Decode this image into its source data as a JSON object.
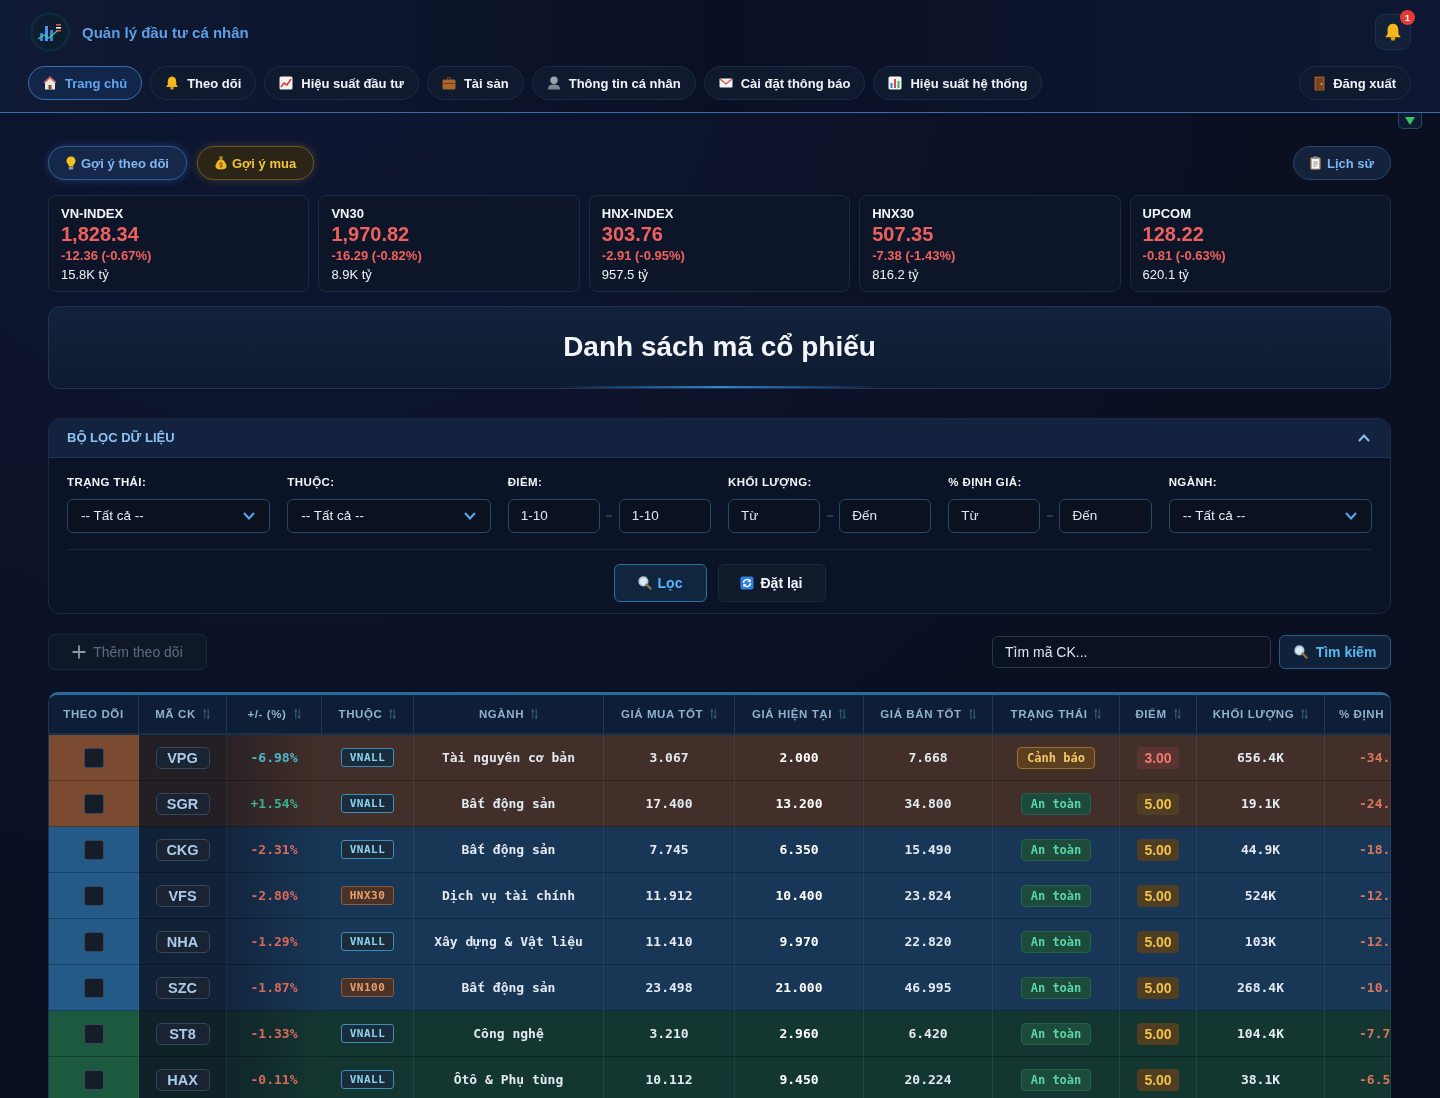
{
  "header": {
    "app_title": "Quản lý đầu tư cá nhân",
    "notification_count": "1",
    "nav": [
      {
        "label": "Trang chủ",
        "selected": true
      },
      {
        "label": "Theo dõi",
        "selected": false
      },
      {
        "label": "Hiệu suất đầu tư",
        "selected": false
      },
      {
        "label": "Tài sản",
        "selected": false
      },
      {
        "label": "Thông tin cá nhân",
        "selected": false
      },
      {
        "label": "Cài đặt thông báo",
        "selected": false
      },
      {
        "label": "Hiệu suất hệ thống",
        "selected": false
      }
    ],
    "logout": "Đăng xuất",
    "panel_toggle": {
      "expanded": false
    }
  },
  "suggestions": [
    {
      "label": "Gợi ý theo dõi",
      "kind": "watch"
    },
    {
      "label": "Gợi ý mua",
      "kind": "buy"
    }
  ],
  "history_button": "Lịch sử",
  "indices": [
    {
      "name": "VN-INDEX",
      "value": "1,828.34",
      "change": "-12.36 (-0.67%)",
      "volume": "15.8K tỷ",
      "falling": true
    },
    {
      "name": "VN30",
      "value": "1,970.82",
      "change": "-16.29 (-0.82%)",
      "volume": "8.9K tỷ",
      "falling": true
    },
    {
      "name": "HNX-INDEX",
      "value": "303.76",
      "change": "-2.91 (-0.95%)",
      "volume": "957.5 tỷ",
      "falling": true
    },
    {
      "name": "HNX30",
      "value": "507.35",
      "change": "-7.38 (-1.43%)",
      "volume": "816.2 tỷ",
      "falling": true
    },
    {
      "name": "UPCOM",
      "value": "128.22",
      "change": "-0.81 (-0.63%)",
      "volume": "620.1 tỷ",
      "falling": true
    }
  ],
  "page_title": "Danh sách mã cổ phiếu",
  "filter": {
    "title": "BỘ LỌC DỮ LIỆU",
    "expanded": true,
    "fields": [
      {
        "kind": "select",
        "label": "TRẠNG THÁI:",
        "value": "-- Tất cả --"
      },
      {
        "kind": "select",
        "label": "THUỘC:",
        "value": "-- Tất cả --"
      },
      {
        "kind": "range",
        "label": "ĐIỂM:",
        "from": {
          "placeholder": "1-10"
        },
        "to": {
          "placeholder": "1-10"
        }
      },
      {
        "kind": "range",
        "label": "KHỐI LƯỢNG:",
        "from": {
          "placeholder": "Từ"
        },
        "to": {
          "placeholder": "Đến"
        }
      },
      {
        "kind": "range",
        "label": "% ĐỊNH GIÁ:",
        "from": {
          "placeholder": "Từ"
        },
        "to": {
          "placeholder": "Đến"
        }
      },
      {
        "kind": "select",
        "label": "NGÀNH:",
        "value": "-- Tất cả --"
      }
    ],
    "buttons": [
      {
        "label": "Lọc",
        "kind": "apply"
      },
      {
        "label": "Đặt lại",
        "kind": "reset"
      }
    ]
  },
  "toolbar": {
    "add_watch": {
      "label": "Thêm theo dõi",
      "disabled": true
    },
    "search": {
      "placeholder": "Tìm mã CK..."
    },
    "search_button": "Tìm kiếm"
  },
  "table": {
    "columns": [
      {
        "label": "THEO DÕI",
        "sortable": false
      },
      {
        "label": "MÃ CK",
        "sortable": true
      },
      {
        "label": "+/- (%)",
        "sortable": true
      },
      {
        "label": "THUỘC",
        "sortable": true
      },
      {
        "label": "NGÀNH",
        "sortable": true
      },
      {
        "label": "GIÁ MUA TỐT",
        "sortable": true
      },
      {
        "label": "GIÁ HIỆN TẠI",
        "sortable": true
      },
      {
        "label": "GIÁ BÁN TỐT",
        "sortable": true
      },
      {
        "label": "TRẠNG THÁI",
        "sortable": true
      },
      {
        "label": "ĐIỂM",
        "sortable": true
      },
      {
        "label": "KHỐI LƯỢNG",
        "sortable": true
      },
      {
        "label": "% ĐỊNH",
        "sortable": false
      }
    ],
    "rows": [
      {
        "color": "#7a4b30",
        "watched": false,
        "ticker": "VPG",
        "change": {
          "text": "-6.98%",
          "kind": "floor"
        },
        "membership": {
          "text": "VNALL",
          "kind": "all"
        },
        "sector": "Tài nguyên cơ bản",
        "buy_price": "3.067",
        "current_price": "2.000",
        "sell_price": "7.668",
        "status": {
          "text": "Cảnh báo",
          "kind": "warning"
        },
        "score": {
          "text": "3.00",
          "kind": "low"
        },
        "volume": "656.4K",
        "valuation": "-34."
      },
      {
        "color": "#7a4b30",
        "watched": false,
        "ticker": "SGR",
        "change": {
          "text": "+1.54%",
          "kind": "up"
        },
        "membership": {
          "text": "VNALL",
          "kind": "all"
        },
        "sector": "Bất động sản",
        "buy_price": "17.400",
        "current_price": "13.200",
        "sell_price": "34.800",
        "status": {
          "text": "An toàn",
          "kind": "safe"
        },
        "score": {
          "text": "5.00",
          "kind": "medium"
        },
        "volume": "19.1K",
        "valuation": "-24."
      },
      {
        "color": "#245a88",
        "watched": false,
        "ticker": "CKG",
        "change": {
          "text": "-2.31%",
          "kind": "down"
        },
        "membership": {
          "text": "VNALL",
          "kind": "all"
        },
        "sector": "Bất động sản",
        "buy_price": "7.745",
        "current_price": "6.350",
        "sell_price": "15.490",
        "status": {
          "text": "An toàn",
          "kind": "safe"
        },
        "score": {
          "text": "5.00",
          "kind": "medium"
        },
        "volume": "44.9K",
        "valuation": "-18."
      },
      {
        "color": "#245a88",
        "watched": false,
        "ticker": "VFS",
        "change": {
          "text": "-2.80%",
          "kind": "down"
        },
        "membership": {
          "text": "HNX30",
          "kind": "basket"
        },
        "sector": "Dịch vụ tài chính",
        "buy_price": "11.912",
        "current_price": "10.400",
        "sell_price": "23.824",
        "status": {
          "text": "An toàn",
          "kind": "safe"
        },
        "score": {
          "text": "5.00",
          "kind": "medium"
        },
        "volume": "524K",
        "valuation": "-12."
      },
      {
        "color": "#245a88",
        "watched": false,
        "ticker": "NHA",
        "change": {
          "text": "-1.29%",
          "kind": "down"
        },
        "membership": {
          "text": "VNALL",
          "kind": "all"
        },
        "sector": "Xây dựng & Vật liệu",
        "buy_price": "11.410",
        "current_price": "9.970",
        "sell_price": "22.820",
        "status": {
          "text": "An toàn",
          "kind": "safe"
        },
        "score": {
          "text": "5.00",
          "kind": "medium"
        },
        "volume": "103K",
        "valuation": "-12."
      },
      {
        "color": "#245a88",
        "watched": false,
        "ticker": "SZC",
        "change": {
          "text": "-1.87%",
          "kind": "down"
        },
        "membership": {
          "text": "VN100",
          "kind": "basket"
        },
        "sector": "Bất động sản",
        "buy_price": "23.498",
        "current_price": "21.000",
        "sell_price": "46.995",
        "status": {
          "text": "An toàn",
          "kind": "safe"
        },
        "score": {
          "text": "5.00",
          "kind": "medium"
        },
        "volume": "268.4K",
        "valuation": "-10."
      },
      {
        "color": "#1b5a3e",
        "watched": false,
        "ticker": "ST8",
        "change": {
          "text": "-1.33%",
          "kind": "down"
        },
        "membership": {
          "text": "VNALL",
          "kind": "all"
        },
        "sector": "Công nghệ",
        "buy_price": "3.210",
        "current_price": "2.960",
        "sell_price": "6.420",
        "status": {
          "text": "An toàn",
          "kind": "safe"
        },
        "score": {
          "text": "5.00",
          "kind": "medium"
        },
        "volume": "104.4K",
        "valuation": "-7.7"
      },
      {
        "color": "#1b5a3e",
        "watched": false,
        "ticker": "HAX",
        "change": {
          "text": "-0.11%",
          "kind": "down"
        },
        "membership": {
          "text": "VNALL",
          "kind": "all"
        },
        "sector": "Ôtô & Phụ tùng",
        "buy_price": "10.112",
        "current_price": "9.450",
        "sell_price": "20.224",
        "status": {
          "text": "An toàn",
          "kind": "safe"
        },
        "score": {
          "text": "5.00",
          "kind": "medium"
        },
        "volume": "38.1K",
        "valuation": "-6.5"
      }
    ]
  }
}
